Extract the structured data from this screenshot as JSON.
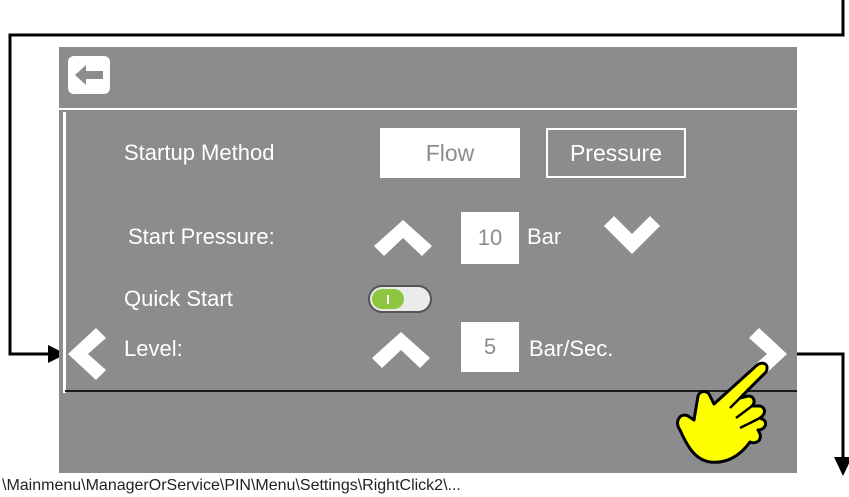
{
  "screen": {
    "labels": {
      "startup_method": "Startup Method",
      "start_pressure": "Start Pressure:",
      "quick_start": "Quick Start",
      "level": "Level:"
    },
    "startup_method": {
      "options": [
        "Flow",
        "Pressure"
      ],
      "selected": "Pressure"
    },
    "start_pressure": {
      "value": "10",
      "unit": "Bar"
    },
    "quick_start": {
      "enabled": true
    },
    "level": {
      "value": "5",
      "unit": "Bar/Sec."
    }
  },
  "icons": {
    "back": "arrow-left-icon",
    "increase": "chevron-up-icon",
    "decrease": "chevron-down-icon",
    "prev_page": "chevron-left-icon",
    "next_page": "chevron-right-icon",
    "pointer": "hand-pointer-icon"
  },
  "colors": {
    "screen_bg": "#8c8c8e",
    "toggle_on": "#8dc63f",
    "hand": "#ffff00"
  },
  "breadcrumb": "\\Mainmenu\\ManagerOrService\\PIN\\Menu\\Settings\\RightClick2\\..."
}
